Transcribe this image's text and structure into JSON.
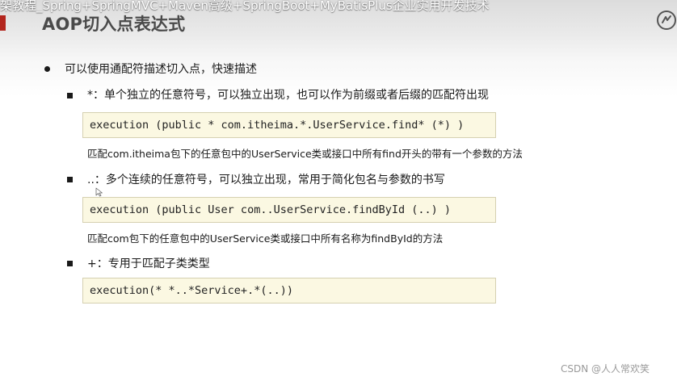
{
  "video_title": "架教程_Spring+SpringMVC+Maven高级+SpringBoot+MyBatisPlus企业实用开发技术",
  "slide": {
    "title": "AOP切入点表达式",
    "intro": "可以使用通配符描述切入点，快速描述"
  },
  "items": [
    {
      "label": "*：单个独立的任意符号，可以独立出现，也可以作为前缀或者后缀的匹配符出现",
      "code": "execution (public * com.itheima.*.UserService.find* (*) )",
      "note": "匹配com.itheima包下的任意包中的UserService类或接口中所有find开头的带有一个参数的方法"
    },
    {
      "label": "..：多个连续的任意符号，可以独立出现，常用于简化包名与参数的书写",
      "code": "execution (public User com..UserService.findById (..) )",
      "note": "匹配com包下的任意包中的UserService类或接口中所有名称为findById的方法"
    },
    {
      "label": "+：专用于匹配子类类型",
      "code": "execution(* *..*Service+.*(..))"
    }
  ],
  "watermark": "CSDN @人人常欢笑",
  "colors": {
    "accent": "#b3261e",
    "code_background": "#fbf8e2",
    "code_border": "#d5d0b1"
  },
  "icons": {
    "corner_logo": "circular-logo-icon",
    "cursor": "mouse-cursor-icon"
  }
}
